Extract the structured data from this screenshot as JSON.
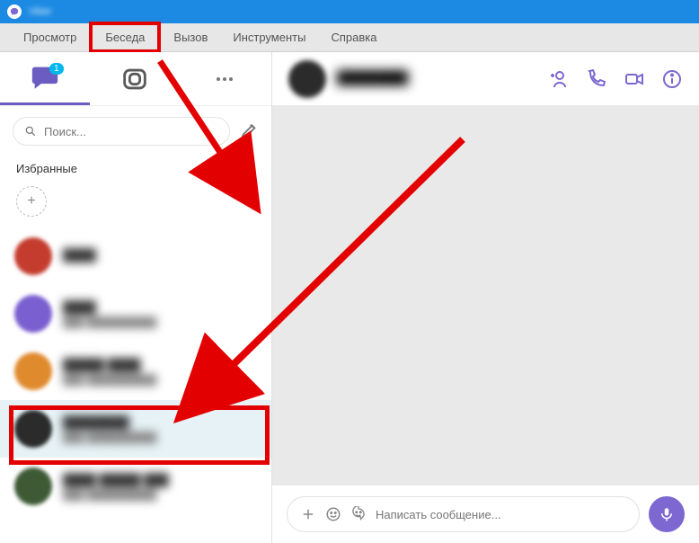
{
  "window": {
    "title": "Viber"
  },
  "menubar": {
    "items": [
      "Просмотр",
      "Беседа",
      "Вызов",
      "Инструменты",
      "Справка"
    ],
    "highlighted_index": 1
  },
  "sidebar": {
    "tabs": {
      "chats_badge": "1"
    },
    "search": {
      "placeholder": "Поиск..."
    },
    "favorites": {
      "label": "Избранные"
    },
    "chats": [
      {
        "name": "████",
        "subtitle": "",
        "avatar_color": "#c43c2d"
      },
      {
        "name": "████",
        "subtitle": "███ ██████████",
        "avatar_color": "#7a5fd0"
      },
      {
        "name": "█████ ████",
        "subtitle": "███ ██████████",
        "avatar_color": "#e08a2e"
      },
      {
        "name": "████████",
        "subtitle": "███ ██████████",
        "avatar_color": "#2b2b2b"
      },
      {
        "name": "████ █████ ███",
        "subtitle": "███ ██████████",
        "avatar_color": "#3d5a35"
      }
    ],
    "selected_index": 3
  },
  "chat": {
    "header": {
      "name": "████████",
      "status": ""
    },
    "composer": {
      "placeholder": "Написать сообщение..."
    }
  },
  "icons": {
    "add_contact": "add-contact-icon",
    "audio_call": "phone-icon",
    "video_call": "video-icon",
    "info": "info-icon",
    "sticker": "sticker-icon",
    "emoji": "emoji-icon",
    "plus": "plus-icon",
    "mic": "mic-icon",
    "search": "search-icon",
    "compose": "compose-icon"
  }
}
